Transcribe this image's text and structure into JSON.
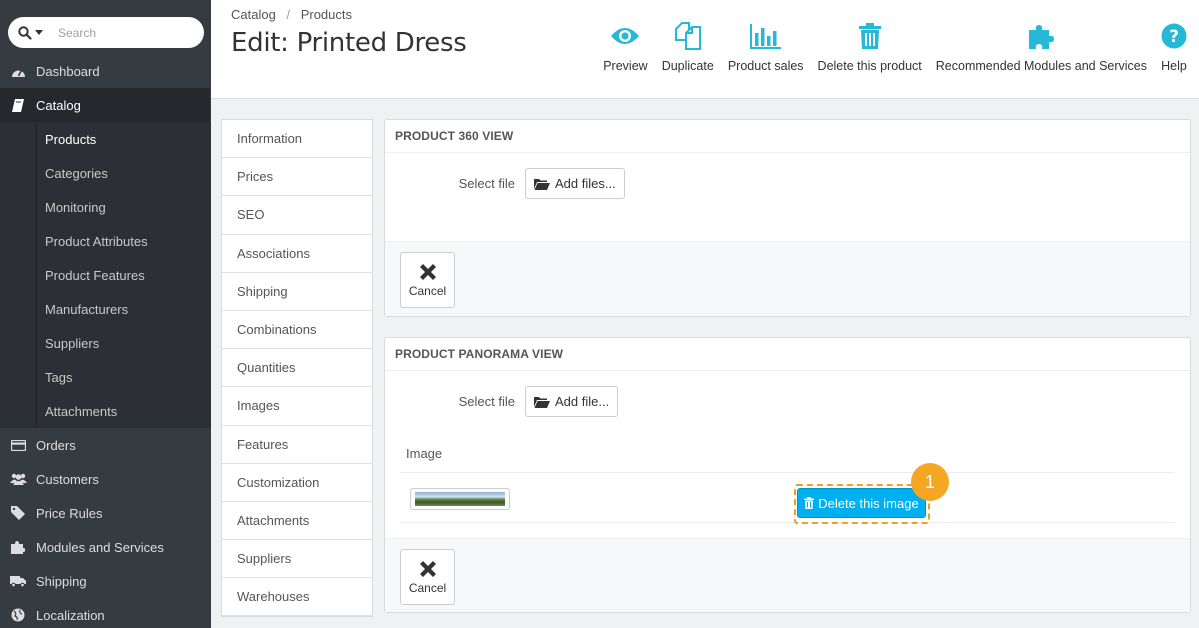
{
  "sidebar": {
    "search_placeholder": "Search",
    "items": [
      {
        "label": "Dashboard",
        "icon": "dashboard-icon"
      },
      {
        "label": "Catalog",
        "icon": "book-icon",
        "active": true
      },
      {
        "label": "Orders",
        "icon": "credit-card-icon"
      },
      {
        "label": "Customers",
        "icon": "users-icon"
      },
      {
        "label": "Price Rules",
        "icon": "tag-icon"
      },
      {
        "label": "Modules and Services",
        "icon": "puzzle-icon"
      },
      {
        "label": "Shipping",
        "icon": "truck-icon"
      },
      {
        "label": "Localization",
        "icon": "globe-icon"
      }
    ],
    "catalog_sub": [
      "Products",
      "Categories",
      "Monitoring",
      "Product Attributes",
      "Product Features",
      "Manufacturers",
      "Suppliers",
      "Tags",
      "Attachments"
    ]
  },
  "header": {
    "breadcrumb": [
      "Catalog",
      "Products"
    ],
    "title": "Edit: Printed Dress",
    "toolbar": [
      "Preview",
      "Duplicate",
      "Product sales",
      "Delete this product",
      "Recommended Modules and Services",
      "Help"
    ]
  },
  "tabs": [
    "Information",
    "Prices",
    "SEO",
    "Associations",
    "Shipping",
    "Combinations",
    "Quantities",
    "Images",
    "Features",
    "Customization",
    "Attachments",
    "Suppliers",
    "Warehouses"
  ],
  "panel360": {
    "heading": "PRODUCT 360 VIEW",
    "select_label": "Select file",
    "add_button": "Add files...",
    "cancel": "Cancel"
  },
  "panorama": {
    "heading": "PRODUCT PANORAMA VIEW",
    "select_label": "Select file",
    "add_button": "Add file...",
    "image_col": "Image",
    "delete_button": "Delete this image",
    "cancel": "Cancel",
    "step": "1"
  },
  "colors": {
    "accent": "#00aff0",
    "highlight": "#f5a623",
    "sidebar": "#363a41"
  }
}
